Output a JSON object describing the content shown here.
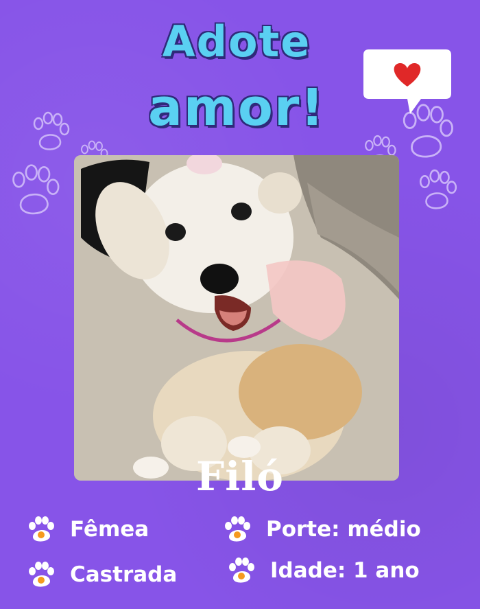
{
  "poster": {
    "title_line1": "Adote",
    "title_line2": "amor!",
    "heart_icon": "heart-icon",
    "pet_name": "Filó",
    "photo_alt": "Foto da cachorrinha Filó",
    "colors": {
      "background": "#8754e8",
      "title": "#5ad0f2",
      "title_outline": "#2f2a7a",
      "heart": "#e02828",
      "paw_badge": "#f59a1e"
    },
    "info": [
      {
        "label": "Fêmea",
        "icon": "paw-icon"
      },
      {
        "label": "Porte: médio",
        "icon": "paw-icon"
      },
      {
        "label": "Castrada",
        "icon": "paw-icon"
      },
      {
        "label": "Idade: 1 ano",
        "icon": "paw-icon"
      }
    ]
  }
}
